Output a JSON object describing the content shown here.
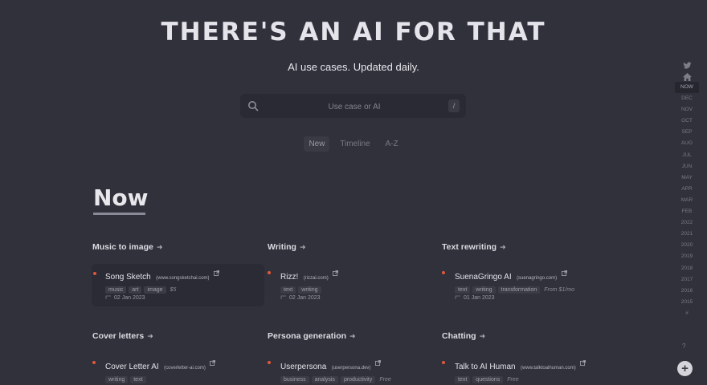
{
  "header": {
    "title": "THERE'S AN AI FOR THAT",
    "subtitle": "AI use cases. Updated daily."
  },
  "search": {
    "placeholder": "Use case or AI",
    "shortcut": "/"
  },
  "view_tabs": [
    {
      "label": "New",
      "active": true
    },
    {
      "label": "Timeline",
      "active": false
    },
    {
      "label": "A-Z",
      "active": false
    }
  ],
  "section": {
    "title": "Now"
  },
  "categories": [
    {
      "title": "Music to image",
      "tools": [
        {
          "name": "Song Sketch",
          "domain": "(www.songsketchai.com)",
          "tags": [
            "music",
            "art",
            "image"
          ],
          "price": "$5",
          "date": "02 Jan 2023"
        }
      ]
    },
    {
      "title": "Writing",
      "tools": [
        {
          "name": "Rizz!",
          "domain": "(rizzai.com)",
          "tags": [
            "text",
            "writing"
          ],
          "price": "",
          "date": "02 Jan 2023"
        }
      ]
    },
    {
      "title": "Text rewriting",
      "tools": [
        {
          "name": "SuenaGringo AI",
          "domain": "(suenagringo.com)",
          "tags": [
            "text",
            "writing",
            "transformation"
          ],
          "price": "From $1/mo",
          "date": "01 Jan 2023"
        }
      ]
    },
    {
      "title": "Cover letters",
      "tools": [
        {
          "name": "Cover Letter AI",
          "domain": "(coverletter-ai.com)",
          "tags": [
            "writing",
            "text"
          ],
          "price": "",
          "date": ""
        }
      ]
    },
    {
      "title": "Persona generation",
      "tools": [
        {
          "name": "Userpersona",
          "domain": "(userpersona.dev)",
          "tags": [
            "business",
            "analysis",
            "productivity"
          ],
          "price": "Free",
          "date": ""
        }
      ]
    },
    {
      "title": "Chatting",
      "tools": [
        {
          "name": "Talk to AI Human",
          "domain": "(www.talktoaihuman.com)",
          "tags": [
            "text",
            "questions"
          ],
          "price": "Free",
          "date": ""
        }
      ]
    }
  ],
  "sidebar": {
    "icons": [
      "twitter-icon",
      "home-icon"
    ],
    "items": [
      "NOW",
      "DEC",
      "NOV",
      "OCT",
      "SEP",
      "AUG",
      "JUL",
      "JUN",
      "MAY",
      "APR",
      "MAR",
      "FEB",
      "2022",
      "2021",
      "2020",
      "2019",
      "2018",
      "2017",
      "2016",
      "2015",
      "#"
    ],
    "active_item": "NOW"
  },
  "help_label": "?",
  "add_label": "+",
  "colors": {
    "background": "#31313c",
    "bullet": "#e0583a",
    "tag_background": "#3c3c47"
  }
}
